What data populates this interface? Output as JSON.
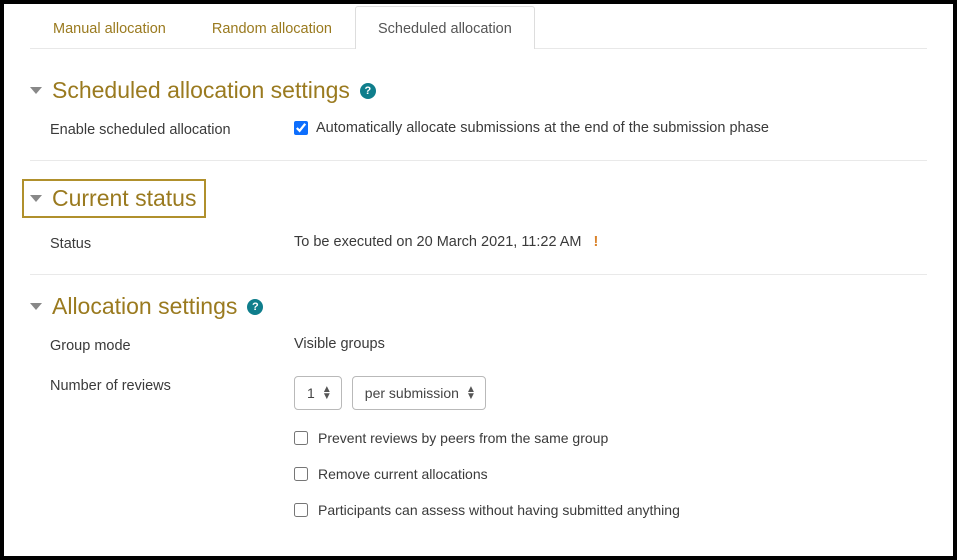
{
  "tabs": {
    "manual": "Manual allocation",
    "random": "Random allocation",
    "scheduled": "Scheduled allocation"
  },
  "scheduled_section": {
    "title": "Scheduled allocation settings",
    "enable_label": "Enable scheduled allocation",
    "enable_desc": "Automatically allocate submissions at the end of the submission phase"
  },
  "current_status": {
    "title": "Current status",
    "status_label": "Status",
    "status_value": "To be executed on 20 March 2021, 11:22 AM"
  },
  "allocation_settings": {
    "title": "Allocation settings",
    "group_mode_label": "Group mode",
    "group_mode_value": "Visible groups",
    "num_reviews_label": "Number of reviews",
    "num_reviews_value": "1",
    "num_reviews_per": "per submission",
    "cb_prevent": "Prevent reviews by peers from the same group",
    "cb_remove": "Remove current allocations",
    "cb_participants": "Participants can assess without having submitted anything"
  }
}
